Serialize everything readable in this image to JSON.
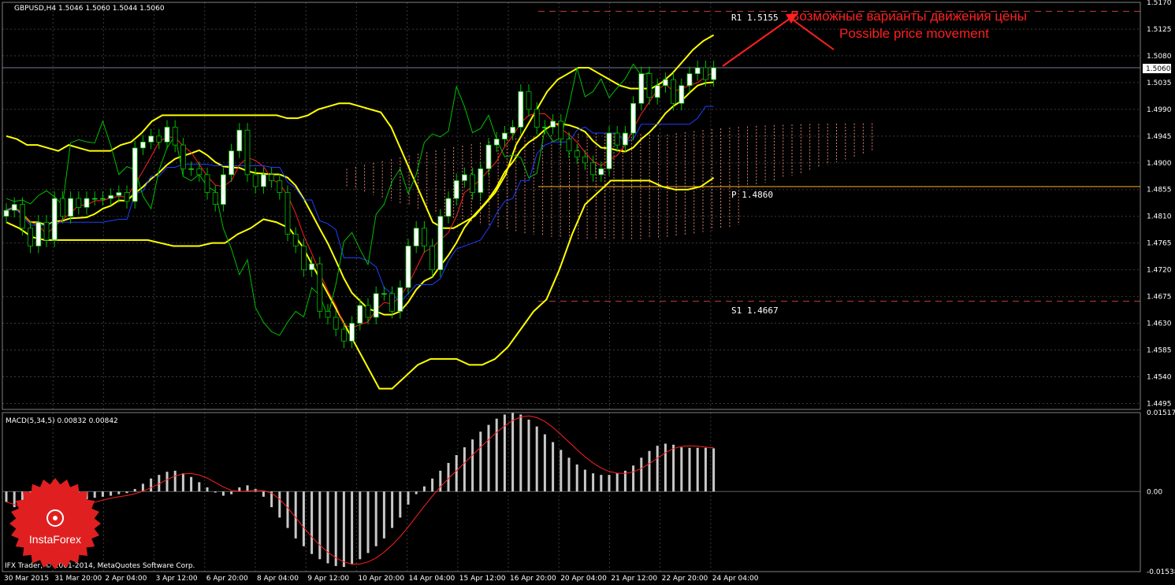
{
  "window": {
    "symbol_header": "GBPUSD,H4  1.5046 1.5060 1.5044 1.5060",
    "macd_header": "MACD(5,34,5) 0.00832 0.00842",
    "copyright": "IFX Trader, © 2001-2014, MetaQuotes Software Corp.",
    "logo_text": "InstaForex"
  },
  "colors": {
    "background": "#000000",
    "grid": "#3a3a3a",
    "bull_candle": "#ffffff",
    "bear_candle": "#000000",
    "bollinger": "#ffff00",
    "red_ma": "#ff2020",
    "blue_ma": "#1f3fff",
    "green_line": "#00c000",
    "pivot_line": "#ffb020",
    "level_dash": "#c0403a",
    "annotation": "#ff2020",
    "macd_hist": "#c8c8c8",
    "macd_signal": "#ff2020",
    "cloud": "#e08070",
    "logo": "#e02020"
  },
  "annotations": {
    "ru": "Возможные варианты движения цены",
    "en": "Possible price movement"
  },
  "levels": {
    "r1": {
      "label": "R1  1.5155",
      "value": 1.5155
    },
    "p": {
      "label": "P  1.4860",
      "value": 1.486
    },
    "s1": {
      "label": "S1  1.4667",
      "value": 1.4667
    }
  },
  "chart_data": [
    {
      "type": "candlestick",
      "title": "GBPUSD,H4  1.5046 1.5060 1.5044 1.5060",
      "last_price": 1.506,
      "last_price_label": "1.5060",
      "y_ticks": [
        "1.5170",
        "1.5125",
        "1.5080",
        "1.5035",
        "1.4990",
        "1.4945",
        "1.4900",
        "1.4855",
        "1.4810",
        "1.4765",
        "1.4720",
        "1.4675",
        "1.4630",
        "1.4585",
        "1.4540",
        "1.4495"
      ],
      "ylim": [
        1.4485,
        1.517
      ],
      "x_ticks": [
        "30 Mar 2015",
        "31 Mar 20:00",
        "2 Apr 04:00",
        "3 Apr 12:00",
        "6 Apr 20:00",
        "8 Apr 04:00",
        "9 Apr 12:00",
        "10 Apr 20:00",
        "14 Apr 04:00",
        "15 Apr 12:00",
        "16 Apr 20:00",
        "20 Apr 04:00",
        "21 Apr 12:00",
        "22 Apr 20:00",
        "24 Apr 04:00"
      ],
      "closes": [
        1.482,
        1.483,
        1.479,
        1.476,
        1.48,
        1.477,
        1.484,
        1.481,
        1.484,
        1.4825,
        1.484,
        1.484,
        1.484,
        1.4845,
        1.485,
        1.4835,
        1.4925,
        1.4935,
        1.4945,
        1.4935,
        1.496,
        1.493,
        1.489,
        1.489,
        1.488,
        1.485,
        1.483,
        1.488,
        1.492,
        1.4955,
        1.488,
        1.486,
        1.488,
        1.487,
        1.485,
        1.478,
        1.476,
        1.472,
        1.473,
        1.465,
        1.464,
        1.462,
        1.46,
        1.463,
        1.466,
        1.464,
        1.468,
        1.468,
        1.465,
        1.469,
        1.476,
        1.479,
        1.476,
        1.472,
        1.481,
        1.484,
        1.487,
        1.488,
        1.485,
        1.489,
        1.493,
        1.494,
        1.495,
        1.496,
        1.502,
        1.499,
        1.496,
        1.496,
        1.497,
        1.494,
        1.492,
        1.491,
        1.49,
        1.488,
        1.489,
        1.495,
        1.493,
        1.495,
        1.5,
        1.505,
        1.501,
        1.503,
        1.504,
        1.5,
        1.503,
        1.505,
        1.506,
        1.504,
        1.506
      ],
      "bollinger_upper": [
        1.4945,
        1.494,
        1.493,
        1.493,
        1.4925,
        1.492,
        1.493,
        1.4925,
        1.492,
        1.492,
        1.492,
        1.493,
        1.4935,
        1.495,
        1.497,
        1.498,
        1.498,
        1.498,
        1.498,
        1.498,
        1.498,
        1.498,
        1.498,
        1.498,
        1.498,
        1.498,
        1.498,
        1.4975,
        1.4975,
        1.498,
        1.499,
        1.4995,
        1.5,
        1.5,
        1.4995,
        1.499,
        1.4985,
        1.496,
        1.492,
        1.488,
        1.484,
        1.48,
        1.479,
        1.479,
        1.48,
        1.481,
        1.483,
        1.485,
        1.488,
        1.493,
        1.496,
        1.499,
        1.502,
        1.504,
        1.505,
        1.506,
        1.506,
        1.505,
        1.504,
        1.503,
        1.5025,
        1.5025,
        1.5025,
        1.5035,
        1.505,
        1.507,
        1.509,
        1.5105,
        1.5115
      ],
      "bollinger_lower": [
        1.48,
        1.479,
        1.4775,
        1.477,
        1.477,
        1.477,
        1.477,
        1.477,
        1.477,
        1.477,
        1.477,
        1.477,
        1.4765,
        1.476,
        1.476,
        1.476,
        1.4765,
        1.4765,
        1.478,
        1.479,
        1.4805,
        1.48,
        1.479,
        1.476,
        1.472,
        1.468,
        1.464,
        1.46,
        1.456,
        1.452,
        1.452,
        1.454,
        1.456,
        1.457,
        1.457,
        1.457,
        1.456,
        1.456,
        1.457,
        1.459,
        1.462,
        1.465,
        1.467,
        1.472,
        1.478,
        1.483,
        1.485,
        1.487,
        1.487,
        1.487,
        1.487,
        1.486,
        1.4855,
        1.4855,
        1.486,
        1.4875
      ]
    },
    {
      "type": "bar",
      "title": "MACD(5,34,5) 0.00832 0.00842",
      "y_ticks": [
        "0.01517",
        "0.00",
        "-0.01538"
      ],
      "ylim": [
        -0.01538,
        0.01517
      ],
      "values": [
        -0.002,
        -0.003,
        -0.004,
        -0.0045,
        -0.0045,
        -0.004,
        -0.0035,
        -0.003,
        -0.0025,
        -0.002,
        -0.0015,
        -0.0012,
        -0.001,
        -0.0008,
        -0.0005,
        -0.0003,
        0.0005,
        0.0015,
        0.0025,
        0.0032,
        0.0038,
        0.004,
        0.0035,
        0.0028,
        0.0018,
        0.0008,
        -0.0002,
        -0.0008,
        -0.0005,
        0.0008,
        0.0012,
        0.0005,
        -0.001,
        -0.003,
        -0.005,
        -0.007,
        -0.009,
        -0.0105,
        -0.012,
        -0.013,
        -0.0138,
        -0.0143,
        -0.0145,
        -0.014,
        -0.013,
        -0.0118,
        -0.0105,
        -0.009,
        -0.007,
        -0.005,
        -0.0025,
        -0.0005,
        0.001,
        0.0025,
        0.004,
        0.0055,
        0.007,
        0.0085,
        0.01,
        0.0115,
        0.0128,
        0.014,
        0.0148,
        0.0152,
        0.0148,
        0.0138,
        0.0125,
        0.011,
        0.0095,
        0.008,
        0.0065,
        0.0052,
        0.0042,
        0.0035,
        0.0032,
        0.0032,
        0.0035,
        0.004,
        0.005,
        0.0065,
        0.0078,
        0.0088,
        0.0092,
        0.009,
        0.0085,
        0.0084,
        0.0084,
        0.0084,
        0.0083
      ]
    }
  ]
}
